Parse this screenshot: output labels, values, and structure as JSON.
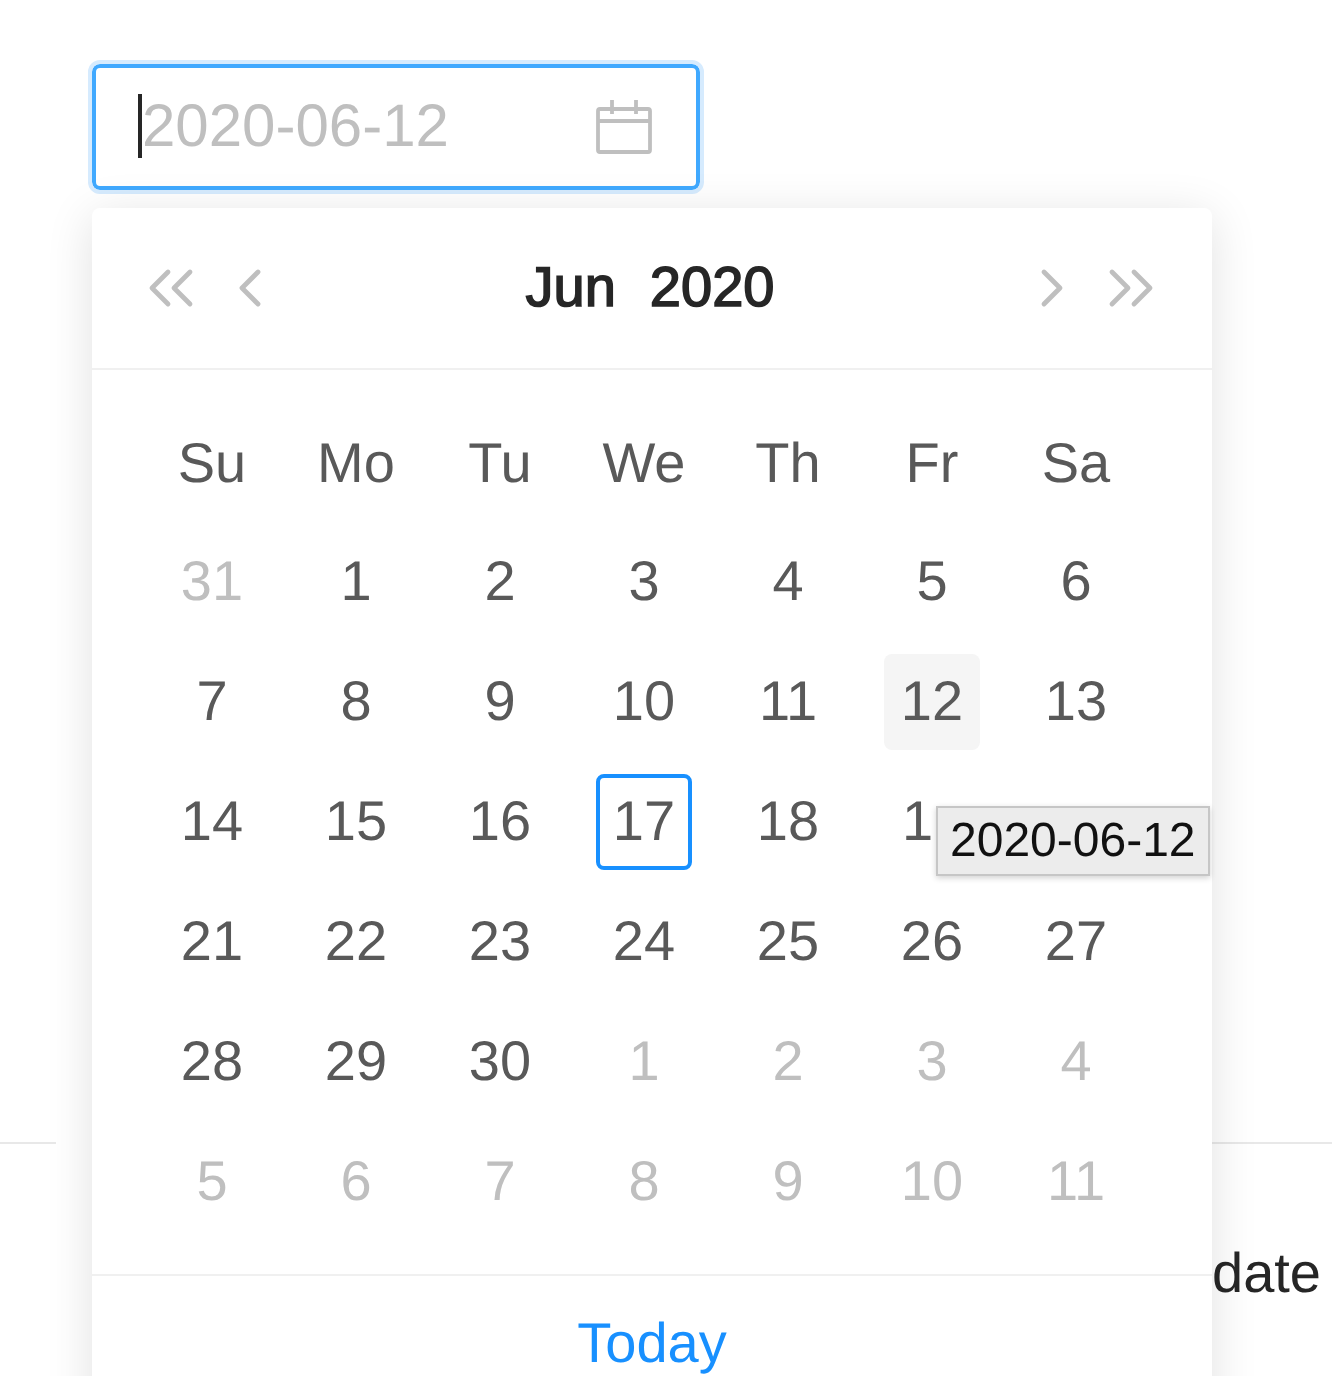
{
  "date_field": {
    "placeholder": "2020-06-12",
    "focused": true
  },
  "calendar": {
    "header": {
      "month": "Jun",
      "year": "2020"
    },
    "weekdays": [
      "Su",
      "Mo",
      "Tu",
      "We",
      "Th",
      "Fr",
      "Sa"
    ],
    "weeks": [
      [
        {
          "day": "31",
          "kind": "outside"
        },
        {
          "day": "1",
          "kind": "inside"
        },
        {
          "day": "2",
          "kind": "inside"
        },
        {
          "day": "3",
          "kind": "inside"
        },
        {
          "day": "4",
          "kind": "inside"
        },
        {
          "day": "5",
          "kind": "inside"
        },
        {
          "day": "6",
          "kind": "inside"
        }
      ],
      [
        {
          "day": "7",
          "kind": "inside"
        },
        {
          "day": "8",
          "kind": "inside"
        },
        {
          "day": "9",
          "kind": "inside"
        },
        {
          "day": "10",
          "kind": "inside"
        },
        {
          "day": "11",
          "kind": "inside"
        },
        {
          "day": "12",
          "kind": "hovered"
        },
        {
          "day": "13",
          "kind": "inside"
        }
      ],
      [
        {
          "day": "14",
          "kind": "inside"
        },
        {
          "day": "15",
          "kind": "inside"
        },
        {
          "day": "16",
          "kind": "inside"
        },
        {
          "day": "17",
          "kind": "today"
        },
        {
          "day": "18",
          "kind": "inside"
        },
        {
          "day": "1",
          "kind": "covered"
        }
      ],
      [
        {
          "day": "21",
          "kind": "inside"
        },
        {
          "day": "22",
          "kind": "inside"
        },
        {
          "day": "23",
          "kind": "inside"
        },
        {
          "day": "24",
          "kind": "inside"
        },
        {
          "day": "25",
          "kind": "inside"
        },
        {
          "day": "26",
          "kind": "inside"
        },
        {
          "day": "27",
          "kind": "inside"
        }
      ],
      [
        {
          "day": "28",
          "kind": "inside"
        },
        {
          "day": "29",
          "kind": "inside"
        },
        {
          "day": "30",
          "kind": "inside"
        },
        {
          "day": "1",
          "kind": "outside"
        },
        {
          "day": "2",
          "kind": "outside"
        },
        {
          "day": "3",
          "kind": "outside"
        },
        {
          "day": "4",
          "kind": "outside"
        }
      ],
      [
        {
          "day": "5",
          "kind": "outside"
        },
        {
          "day": "6",
          "kind": "outside"
        },
        {
          "day": "7",
          "kind": "outside"
        },
        {
          "day": "8",
          "kind": "outside"
        },
        {
          "day": "9",
          "kind": "outside"
        },
        {
          "day": "10",
          "kind": "outside"
        },
        {
          "day": "11",
          "kind": "outside"
        }
      ]
    ],
    "footer": {
      "today_link": "Today"
    }
  },
  "tooltip": {
    "text": "2020-06-12"
  },
  "background": {
    "label": "date"
  }
}
